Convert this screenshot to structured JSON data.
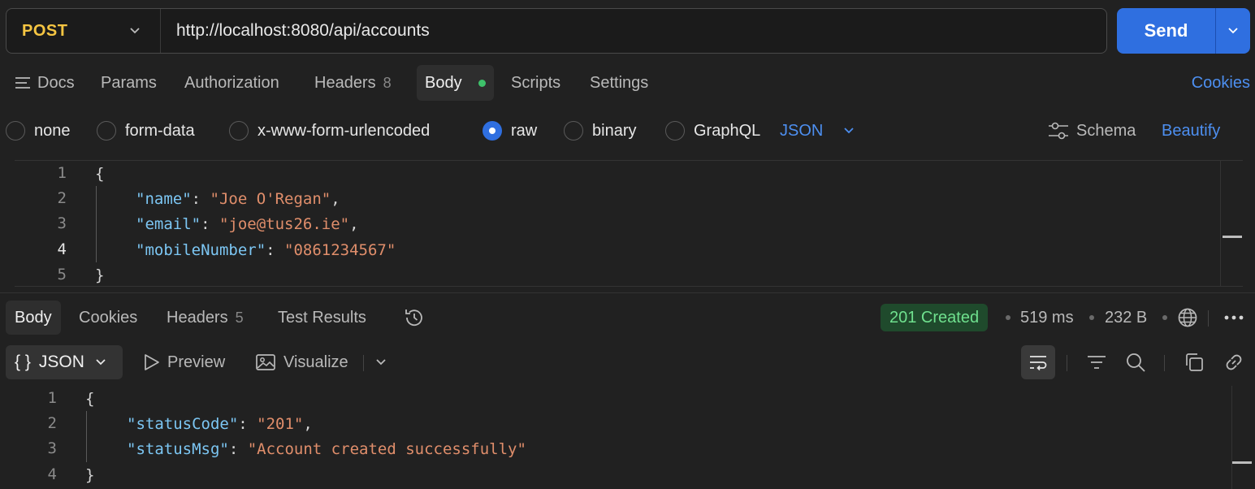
{
  "request": {
    "method": "POST",
    "url": "http://localhost:8080/api/accounts",
    "send_label": "Send"
  },
  "request_tabs": {
    "docs": "Docs",
    "params": "Params",
    "authorization": "Authorization",
    "headers": "Headers",
    "headers_count": "8",
    "body": "Body",
    "scripts": "Scripts",
    "settings": "Settings",
    "cookies": "Cookies"
  },
  "body_types": {
    "none": "none",
    "form_data": "form-data",
    "urlencoded": "x-www-form-urlencoded",
    "raw": "raw",
    "binary": "binary",
    "graphql": "GraphQL",
    "selected": "raw",
    "format": "JSON",
    "schema": "Schema",
    "beautify": "Beautify"
  },
  "request_body": {
    "line_numbers": [
      "1",
      "2",
      "3",
      "4",
      "5"
    ],
    "open_brace": "{",
    "close_brace": "}",
    "fields": [
      {
        "key": "\"name\"",
        "value": "\"Joe O'Regan\"",
        "trail": ","
      },
      {
        "key": "\"email\"",
        "value": "\"joe@tus26.ie\"",
        "trail": ","
      },
      {
        "key": "\"mobileNumber\"",
        "value": "\"0861234567\"",
        "trail": ""
      }
    ]
  },
  "response_tabs": {
    "body": "Body",
    "cookies": "Cookies",
    "headers": "Headers",
    "headers_count": "5",
    "test_results": "Test Results"
  },
  "response_meta": {
    "status": "201 Created",
    "time": "519 ms",
    "size": "232 B"
  },
  "response_toolbar": {
    "format": "JSON",
    "format_icon": "{ }",
    "preview": "Preview",
    "visualize": "Visualize"
  },
  "response_body": {
    "line_numbers": [
      "1",
      "2",
      "3",
      "4"
    ],
    "open_brace": "{",
    "close_brace": "}",
    "fields": [
      {
        "key": "\"statusCode\"",
        "value": "\"201\"",
        "trail": ","
      },
      {
        "key": "\"statusMsg\"",
        "value": "\"Account created successfully\"",
        "trail": ""
      }
    ]
  },
  "colors": {
    "method": "#f5c542",
    "accent": "#2f6fe0",
    "link": "#4d8ff0",
    "status_ok": "#6fe08e",
    "json_key": "#7cc6f3",
    "json_string": "#e08e6b"
  },
  "icons": [
    "chevron-down-icon",
    "docs-icon",
    "schema-icon",
    "history-icon",
    "preview-icon",
    "visualize-icon",
    "wrap-icon",
    "filter-icon",
    "search-icon",
    "globe-icon",
    "more-icon",
    "copy-icon",
    "link-icon"
  ]
}
